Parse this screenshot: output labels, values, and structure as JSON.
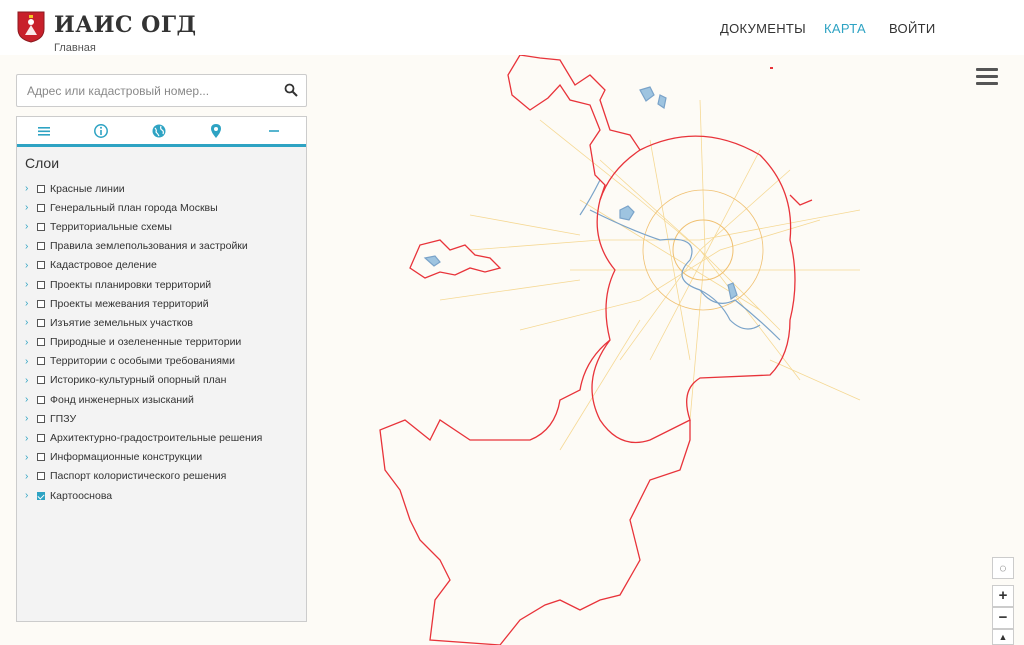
{
  "header": {
    "title": "ИАИС ОГД",
    "breadcrumb": "Главная",
    "nav": [
      {
        "label": "ДОКУМЕНТЫ",
        "active": false
      },
      {
        "label": "КАРТА",
        "active": true
      },
      {
        "label": "ВОЙТИ",
        "active": false
      }
    ]
  },
  "search": {
    "placeholder": "Адрес или кадастровый номер..."
  },
  "panel": {
    "tabs": [
      "list-icon",
      "info-icon",
      "globe-icon",
      "pin-icon",
      "minus-icon"
    ],
    "title": "Слои",
    "layers": [
      {
        "label": "Красные линии",
        "checked": false
      },
      {
        "label": "Генеральный план города Москвы",
        "checked": false
      },
      {
        "label": "Территориальные схемы",
        "checked": false
      },
      {
        "label": "Правила землепользования и застройки",
        "checked": false
      },
      {
        "label": "Кадастровое деление",
        "checked": false
      },
      {
        "label": "Проекты планировки территорий",
        "checked": false
      },
      {
        "label": "Проекты межевания территорий",
        "checked": false
      },
      {
        "label": "Изъятие земельных участков",
        "checked": false
      },
      {
        "label": "Природные и озелененные территории",
        "checked": false
      },
      {
        "label": "Территории с особыми требованиями",
        "checked": false
      },
      {
        "label": "Историко-культурный опорный план",
        "checked": false
      },
      {
        "label": "Фонд инженерных изысканий",
        "checked": false
      },
      {
        "label": "ГПЗУ",
        "checked": false
      },
      {
        "label": "Архитектурно-градостроительные решения",
        "checked": false
      },
      {
        "label": "Информационные конструкции",
        "checked": false
      },
      {
        "label": "Паспорт колористического решения",
        "checked": false
      },
      {
        "label": "Картооснова",
        "checked": true
      }
    ]
  },
  "map_controls": {
    "zoom_in": "+",
    "zoom_out": "−",
    "compass": "▲"
  },
  "colors": {
    "accent": "#2ea3c3",
    "boundary": "#e8333a",
    "water": "#8ab8d8",
    "roads": "#f5d58a"
  }
}
